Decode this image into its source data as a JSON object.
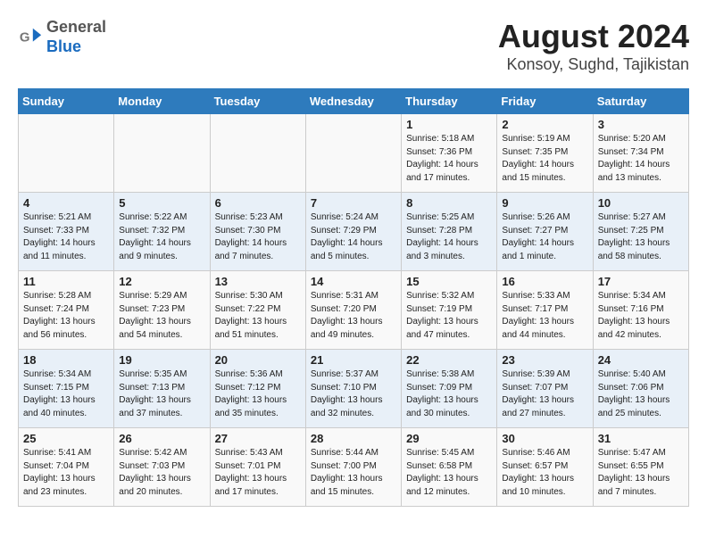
{
  "header": {
    "logo_line1": "General",
    "logo_line2": "Blue",
    "title": "August 2024",
    "subtitle": "Konsoy, Sughd, Tajikistan"
  },
  "days_of_week": [
    "Sunday",
    "Monday",
    "Tuesday",
    "Wednesday",
    "Thursday",
    "Friday",
    "Saturday"
  ],
  "weeks": [
    [
      {
        "day": "",
        "info": ""
      },
      {
        "day": "",
        "info": ""
      },
      {
        "day": "",
        "info": ""
      },
      {
        "day": "",
        "info": ""
      },
      {
        "day": "1",
        "info": "Sunrise: 5:18 AM\nSunset: 7:36 PM\nDaylight: 14 hours\nand 17 minutes."
      },
      {
        "day": "2",
        "info": "Sunrise: 5:19 AM\nSunset: 7:35 PM\nDaylight: 14 hours\nand 15 minutes."
      },
      {
        "day": "3",
        "info": "Sunrise: 5:20 AM\nSunset: 7:34 PM\nDaylight: 14 hours\nand 13 minutes."
      }
    ],
    [
      {
        "day": "4",
        "info": "Sunrise: 5:21 AM\nSunset: 7:33 PM\nDaylight: 14 hours\nand 11 minutes."
      },
      {
        "day": "5",
        "info": "Sunrise: 5:22 AM\nSunset: 7:32 PM\nDaylight: 14 hours\nand 9 minutes."
      },
      {
        "day": "6",
        "info": "Sunrise: 5:23 AM\nSunset: 7:30 PM\nDaylight: 14 hours\nand 7 minutes."
      },
      {
        "day": "7",
        "info": "Sunrise: 5:24 AM\nSunset: 7:29 PM\nDaylight: 14 hours\nand 5 minutes."
      },
      {
        "day": "8",
        "info": "Sunrise: 5:25 AM\nSunset: 7:28 PM\nDaylight: 14 hours\nand 3 minutes."
      },
      {
        "day": "9",
        "info": "Sunrise: 5:26 AM\nSunset: 7:27 PM\nDaylight: 14 hours\nand 1 minute."
      },
      {
        "day": "10",
        "info": "Sunrise: 5:27 AM\nSunset: 7:25 PM\nDaylight: 13 hours\nand 58 minutes."
      }
    ],
    [
      {
        "day": "11",
        "info": "Sunrise: 5:28 AM\nSunset: 7:24 PM\nDaylight: 13 hours\nand 56 minutes."
      },
      {
        "day": "12",
        "info": "Sunrise: 5:29 AM\nSunset: 7:23 PM\nDaylight: 13 hours\nand 54 minutes."
      },
      {
        "day": "13",
        "info": "Sunrise: 5:30 AM\nSunset: 7:22 PM\nDaylight: 13 hours\nand 51 minutes."
      },
      {
        "day": "14",
        "info": "Sunrise: 5:31 AM\nSunset: 7:20 PM\nDaylight: 13 hours\nand 49 minutes."
      },
      {
        "day": "15",
        "info": "Sunrise: 5:32 AM\nSunset: 7:19 PM\nDaylight: 13 hours\nand 47 minutes."
      },
      {
        "day": "16",
        "info": "Sunrise: 5:33 AM\nSunset: 7:17 PM\nDaylight: 13 hours\nand 44 minutes."
      },
      {
        "day": "17",
        "info": "Sunrise: 5:34 AM\nSunset: 7:16 PM\nDaylight: 13 hours\nand 42 minutes."
      }
    ],
    [
      {
        "day": "18",
        "info": "Sunrise: 5:34 AM\nSunset: 7:15 PM\nDaylight: 13 hours\nand 40 minutes."
      },
      {
        "day": "19",
        "info": "Sunrise: 5:35 AM\nSunset: 7:13 PM\nDaylight: 13 hours\nand 37 minutes."
      },
      {
        "day": "20",
        "info": "Sunrise: 5:36 AM\nSunset: 7:12 PM\nDaylight: 13 hours\nand 35 minutes."
      },
      {
        "day": "21",
        "info": "Sunrise: 5:37 AM\nSunset: 7:10 PM\nDaylight: 13 hours\nand 32 minutes."
      },
      {
        "day": "22",
        "info": "Sunrise: 5:38 AM\nSunset: 7:09 PM\nDaylight: 13 hours\nand 30 minutes."
      },
      {
        "day": "23",
        "info": "Sunrise: 5:39 AM\nSunset: 7:07 PM\nDaylight: 13 hours\nand 27 minutes."
      },
      {
        "day": "24",
        "info": "Sunrise: 5:40 AM\nSunset: 7:06 PM\nDaylight: 13 hours\nand 25 minutes."
      }
    ],
    [
      {
        "day": "25",
        "info": "Sunrise: 5:41 AM\nSunset: 7:04 PM\nDaylight: 13 hours\nand 23 minutes."
      },
      {
        "day": "26",
        "info": "Sunrise: 5:42 AM\nSunset: 7:03 PM\nDaylight: 13 hours\nand 20 minutes."
      },
      {
        "day": "27",
        "info": "Sunrise: 5:43 AM\nSunset: 7:01 PM\nDaylight: 13 hours\nand 17 minutes."
      },
      {
        "day": "28",
        "info": "Sunrise: 5:44 AM\nSunset: 7:00 PM\nDaylight: 13 hours\nand 15 minutes."
      },
      {
        "day": "29",
        "info": "Sunrise: 5:45 AM\nSunset: 6:58 PM\nDaylight: 13 hours\nand 12 minutes."
      },
      {
        "day": "30",
        "info": "Sunrise: 5:46 AM\nSunset: 6:57 PM\nDaylight: 13 hours\nand 10 minutes."
      },
      {
        "day": "31",
        "info": "Sunrise: 5:47 AM\nSunset: 6:55 PM\nDaylight: 13 hours\nand 7 minutes."
      }
    ]
  ]
}
